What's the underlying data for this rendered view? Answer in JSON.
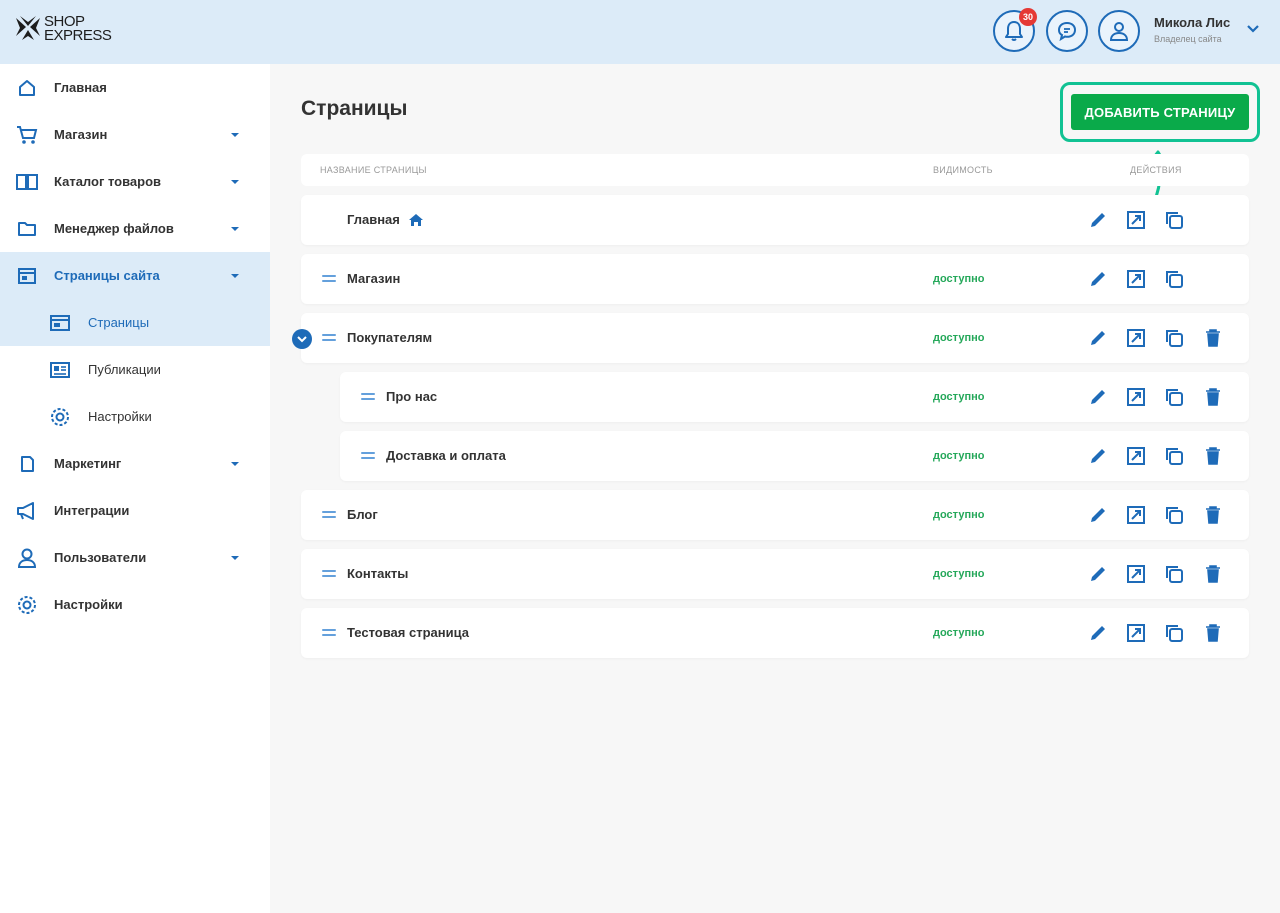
{
  "header": {
    "logo_text_line1": "SHOP",
    "logo_text_line2": "EXPRESS",
    "notifications_count": "30",
    "user_name": "Микола Лис",
    "user_role": "Владелец сайта"
  },
  "sidebar": {
    "items": [
      {
        "label": "Главная",
        "icon": "home-icon"
      },
      {
        "label": "Магазин",
        "icon": "cart-icon"
      },
      {
        "label": "Каталог товаров",
        "icon": "book-icon"
      },
      {
        "label": "Менеджер файлов",
        "icon": "folder-icon"
      },
      {
        "label": "Страницы сайта",
        "icon": "browser-icon"
      },
      {
        "label": "Маркетинг",
        "icon": "tag-icon"
      },
      {
        "label": "Интеграции",
        "icon": "megaphone-icon"
      },
      {
        "label": "Пользователи",
        "icon": "user-icon"
      },
      {
        "label": "Настройки",
        "icon": "gear-icon"
      }
    ],
    "sub_items": [
      {
        "label": "Страницы",
        "icon": "browser-icon"
      },
      {
        "label": "Публикации",
        "icon": "newspaper-icon"
      },
      {
        "label": "Настройки",
        "icon": "gear-icon"
      }
    ]
  },
  "main": {
    "title": "Страницы",
    "add_button_label": "ДОБАВИТЬ СТРАНИЦУ",
    "columns": {
      "name": "Название страницы",
      "visibility": "Видимость",
      "actions": "Действия"
    },
    "rows": [
      {
        "name": "Главная",
        "status": ""
      },
      {
        "name": "Магазин",
        "status": "доступно"
      },
      {
        "name": "Покупателям",
        "status": "доступно"
      },
      {
        "name": "Про нас",
        "status": "доступно"
      },
      {
        "name": "Доставка и оплата",
        "status": "доступно"
      },
      {
        "name": "Блог",
        "status": "доступно"
      },
      {
        "name": "Контакты",
        "status": "доступно"
      },
      {
        "name": "Тестовая страница",
        "status": "доступно"
      }
    ]
  },
  "colors": {
    "accent": "#1e6bb8",
    "header_bg": "#dcebf8",
    "add_button": "#0aaa4a",
    "highlight": "#11c293",
    "status_green": "#25a85a"
  }
}
